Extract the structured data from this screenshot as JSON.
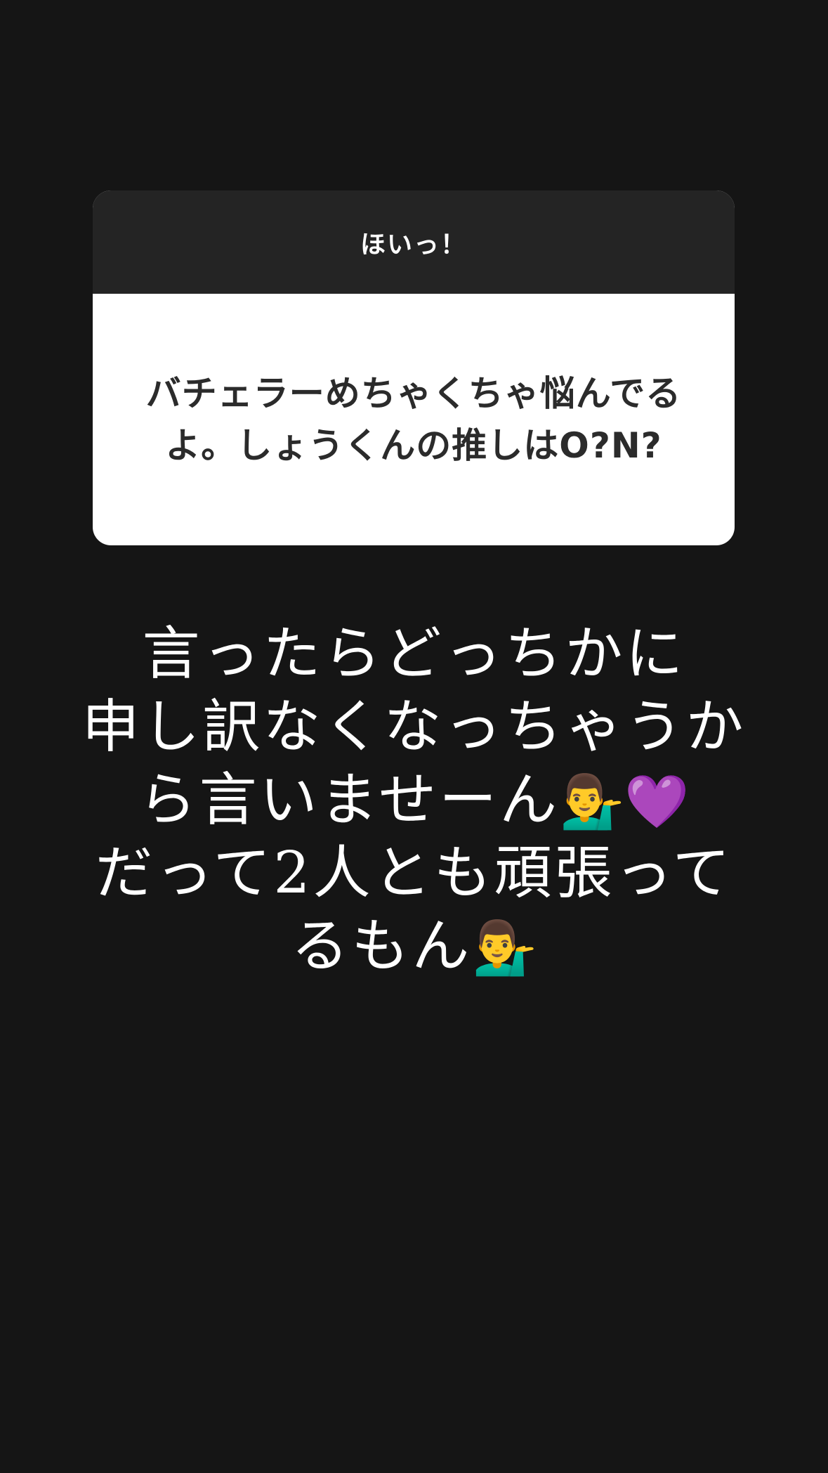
{
  "question_card": {
    "header": "ほいっ！",
    "question": "バチェラーめちゃくちゃ悩んでるよ。しょうくんの推しはO?N?"
  },
  "reply": {
    "lines": [
      {
        "text": "言ったらどっちかに",
        "emoji": ""
      },
      {
        "text": "申し訳なくなっちゃうか",
        "emoji": ""
      },
      {
        "text": "ら言いませーん",
        "emoji": "💁‍♂️💜"
      },
      {
        "text": "だって2人とも頑張って",
        "emoji": ""
      },
      {
        "text": "るもん",
        "emoji": "💁‍♂️"
      }
    ]
  },
  "colors": {
    "background": "#151515",
    "card_header": "#242424",
    "card_body": "#ffffff",
    "question_text": "#2b2b2b",
    "reply_text": "#ffffff"
  }
}
